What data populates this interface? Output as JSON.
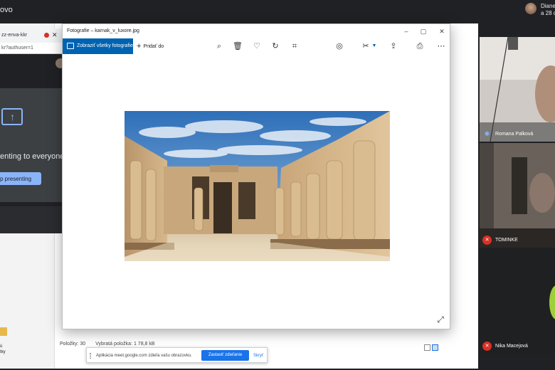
{
  "meet": {
    "title_fragment": "ovo",
    "presenter_name": "Diane",
    "presenter_sub": "a 28 c"
  },
  "chrome": {
    "tab_label": "zz-enva-kkr",
    "url": "kr?authuser=1",
    "presenting_text": "enting to everyone",
    "stop_button": "p presenting"
  },
  "photos": {
    "title": "Fotografie – karnak_v_luxore.jpg",
    "all_photos_label": "Zobraziť všetky fotografie",
    "add_to_label": "Pridať do"
  },
  "explorer": {
    "items": "Položky: 30",
    "selected": "Vybratá položka: 1  78,8 kB"
  },
  "desktop": {
    "label1": "ú",
    "label2": "tky"
  },
  "share_bar": {
    "text": "Aplikácia meet.google.com zdieľa vašu obrazovku.",
    "stop_label": "Zastaviť zdieľanie",
    "hide_label": "Skryť"
  },
  "participants": [
    {
      "name": "Romana Palková",
      "muted": false
    },
    {
      "name": "TOMINKE",
      "muted": true
    },
    {
      "name": "Nika Macejová",
      "muted": true
    }
  ],
  "colors": {
    "meet_bg": "#202124",
    "photos_accent": "#0063b1",
    "meet_blue": "#1a73e8",
    "mic_off_red": "#d93025"
  }
}
